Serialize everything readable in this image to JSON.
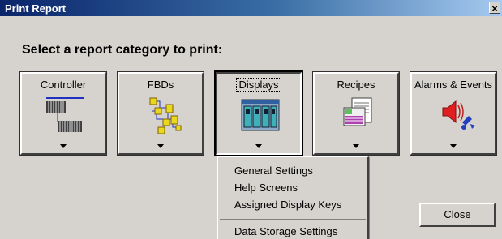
{
  "window": {
    "title": "Print Report",
    "close_glyph": "×"
  },
  "heading": "Select a report category to print:",
  "categories": [
    {
      "label": "Controller",
      "icon": "controller-icon"
    },
    {
      "label": "FBDs",
      "icon": "fbd-icon"
    },
    {
      "label": "Displays",
      "icon": "displays-icon",
      "selected": true
    },
    {
      "label": "Recipes",
      "icon": "recipes-icon"
    },
    {
      "label": "Alarms & Events",
      "icon": "alarm-speaker-icon"
    }
  ],
  "dropdown_menu": {
    "items": [
      {
        "label": "General Settings"
      },
      {
        "label": "Help Screens"
      },
      {
        "label": "Assigned Display Keys"
      },
      {
        "label": "Data Storage Settings"
      }
    ]
  },
  "buttons": {
    "close_label": "Close"
  },
  "colors": {
    "titlebar_start": "#0a246a",
    "titlebar_end": "#a6caf0",
    "dialog_bg": "#d6d3ce"
  }
}
